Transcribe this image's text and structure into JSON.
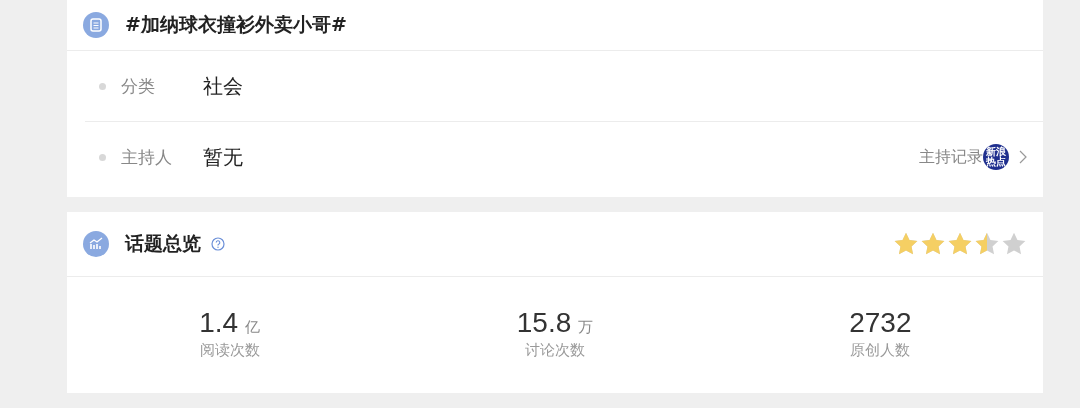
{
  "topic": {
    "title": "#加纳球衣撞衫外卖小哥#",
    "fields": [
      {
        "label": "分类",
        "value": "社会"
      },
      {
        "label": "主持人",
        "value": "暂无"
      }
    ],
    "host_record": {
      "label": "主持记录",
      "badge": "新浪热点"
    }
  },
  "overview": {
    "title": "话题总览",
    "stars": 3.5,
    "stats": [
      {
        "number": "1.4",
        "unit": "亿",
        "label": "阅读次数"
      },
      {
        "number": "15.8",
        "unit": "万",
        "label": "讨论次数"
      },
      {
        "number": "2732",
        "label": "原创人数"
      }
    ]
  }
}
